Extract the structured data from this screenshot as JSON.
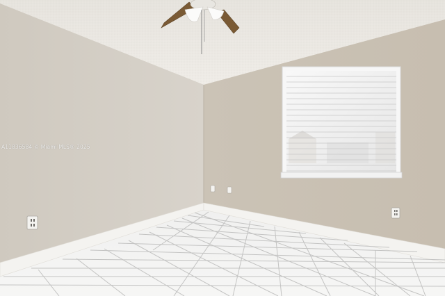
{
  "photo": {
    "watermark": "A11836584 © Miami MLS® 2025",
    "colors": {
      "ceiling": "#ebe8e2",
      "wall_left": "#d2ccc2",
      "wall_right": "#c9c0b3",
      "floor_tile": "#f3f3f2",
      "grout": "#bfbfbf",
      "baseboard": "#f4f3f0",
      "window_frame": "#f7f7f7",
      "fan_blade": "#7a5a34"
    }
  }
}
